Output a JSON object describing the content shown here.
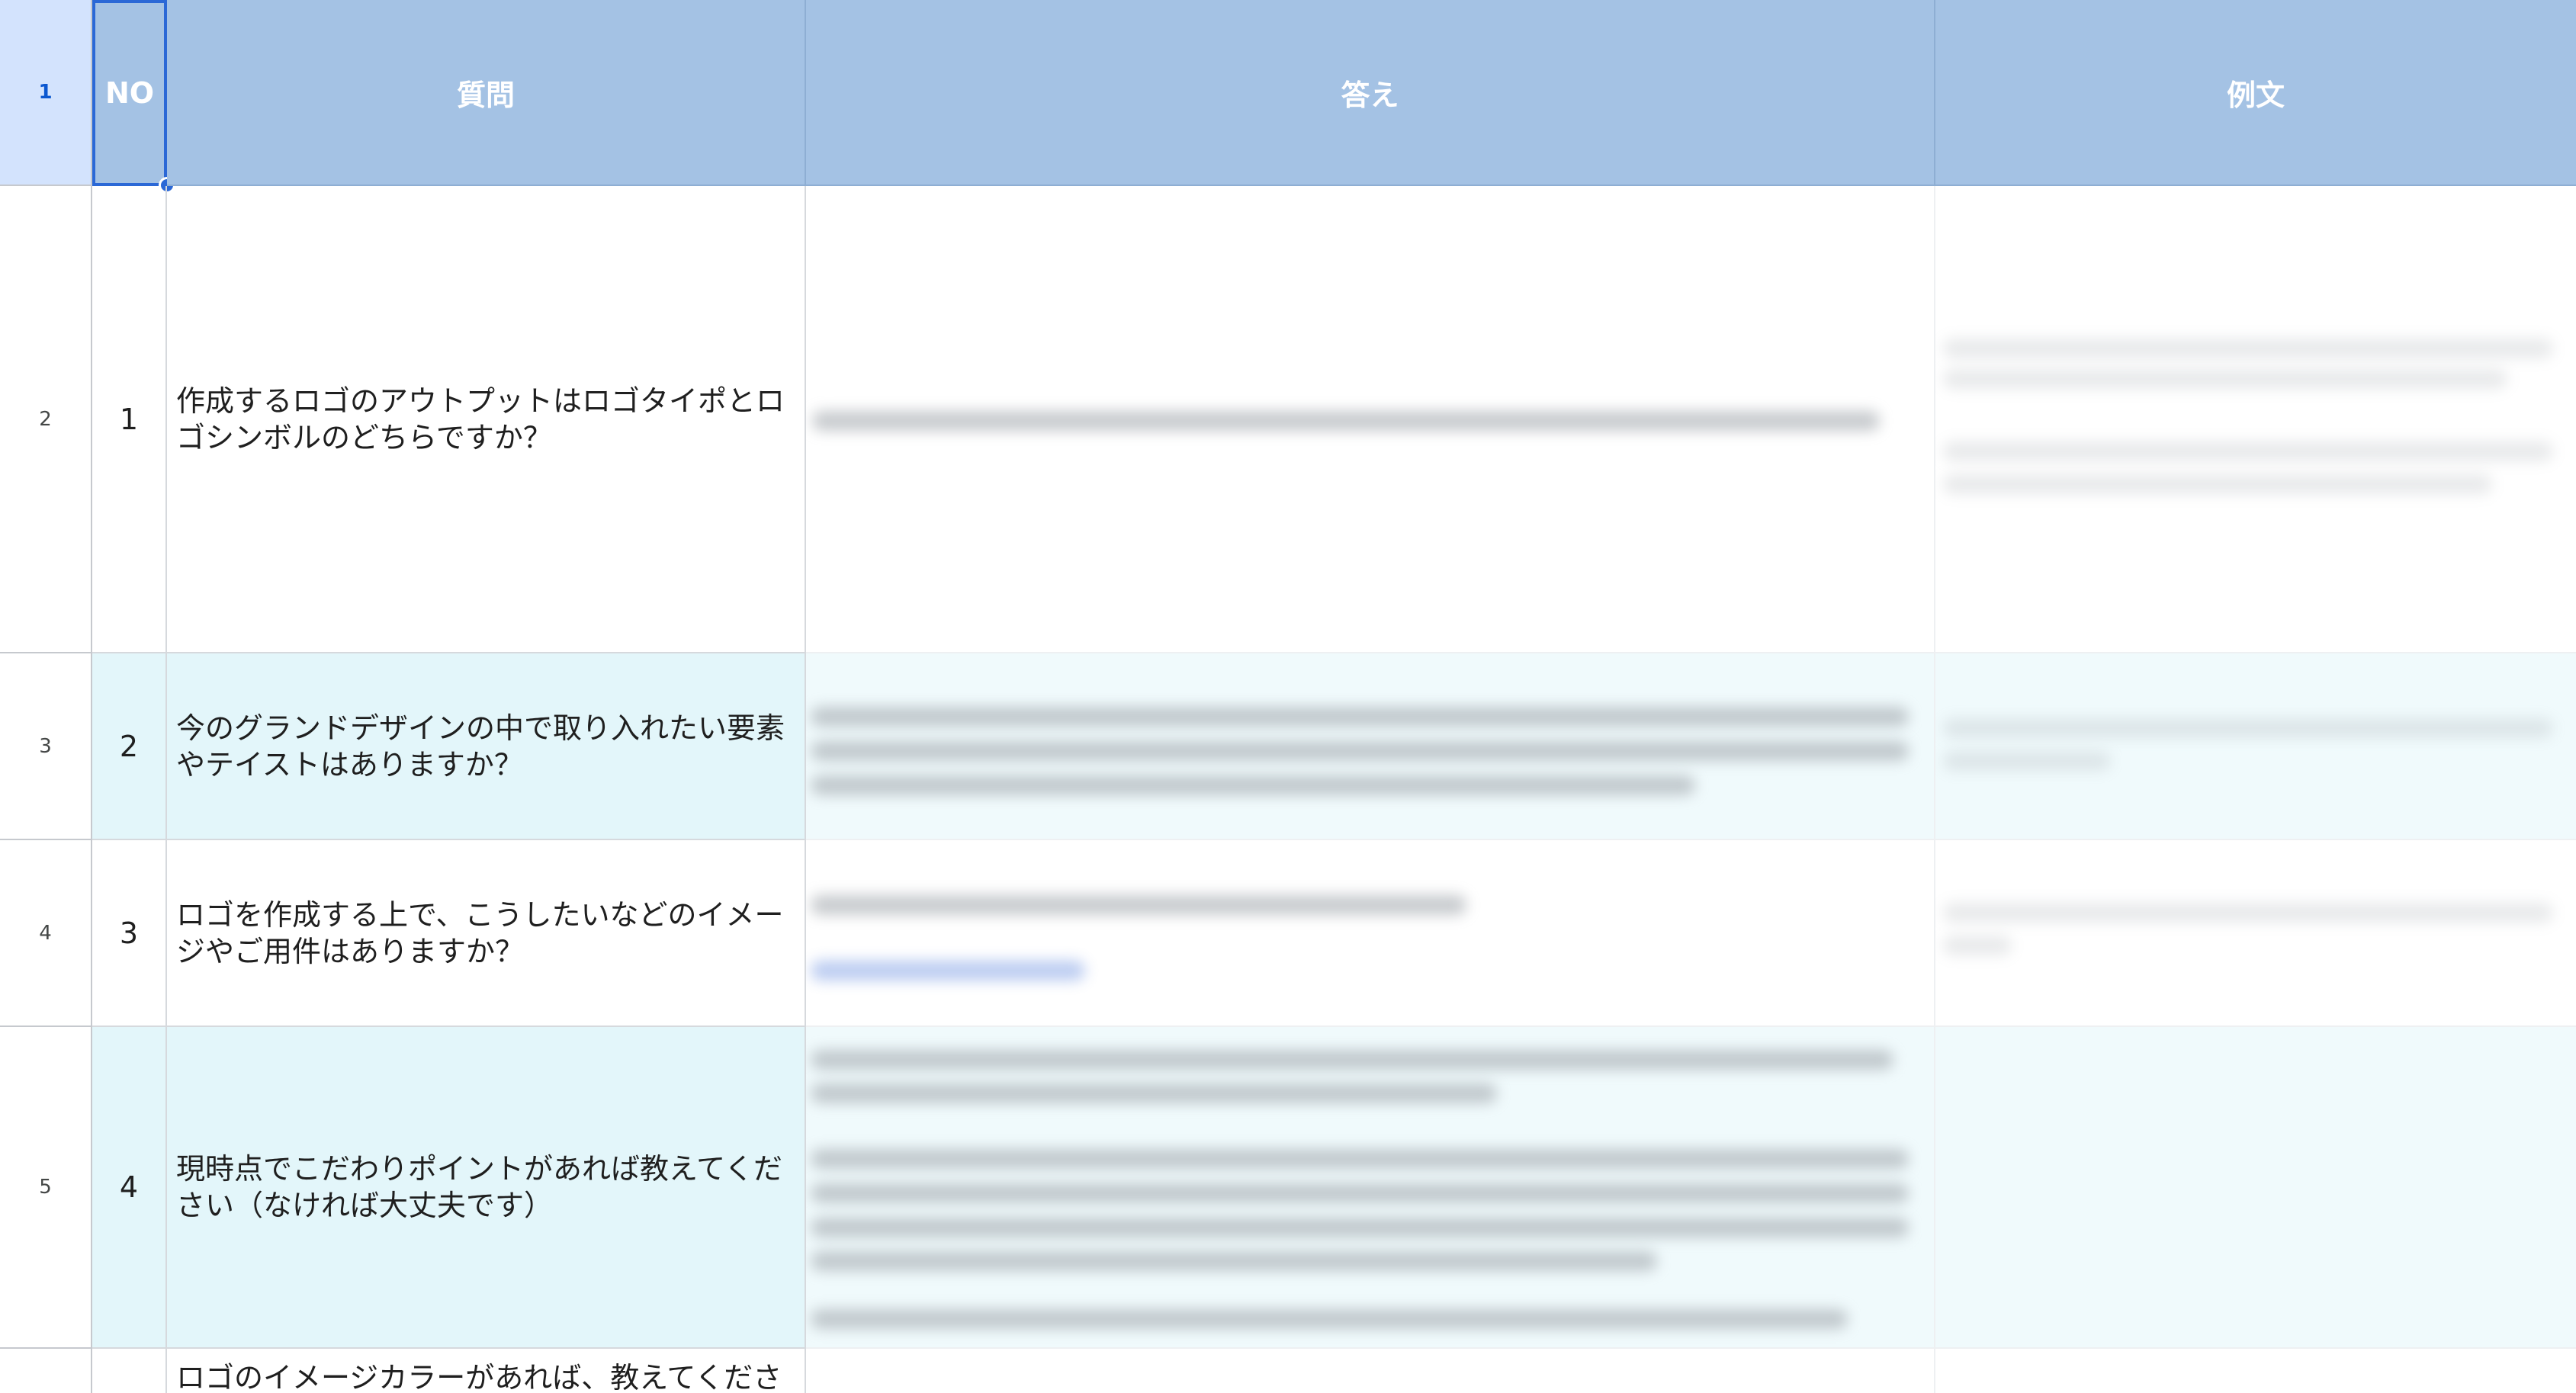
{
  "header": {
    "row_number": "1",
    "col_no": "NO",
    "col_question": "質問",
    "col_answer": "答え",
    "col_example": "例文"
  },
  "rows": [
    {
      "row_number": "2",
      "no": "1",
      "question": "作成するロゴのアウトプットはロゴタイポとロゴシンボルのどちらですか？"
    },
    {
      "row_number": "3",
      "no": "2",
      "question": "今のグランドデザインの中で取り入れたい要素やテイストはありますか？"
    },
    {
      "row_number": "4",
      "no": "3",
      "question": "ロゴを作成する上で、こうしたいなどのイメージやご用件はありますか？"
    },
    {
      "row_number": "5",
      "no": "4",
      "question": "現時点でこだわりポイントがあれば教えてください（なければ大丈夫です）"
    },
    {
      "row_number": "",
      "no": "",
      "question": "ロゴのイメージカラーがあれば、教えてくださ"
    }
  ],
  "colors": {
    "header_bg": "#a4c2e4",
    "selection": "#2b68d6",
    "alt_row": "#e3f6fa"
  }
}
